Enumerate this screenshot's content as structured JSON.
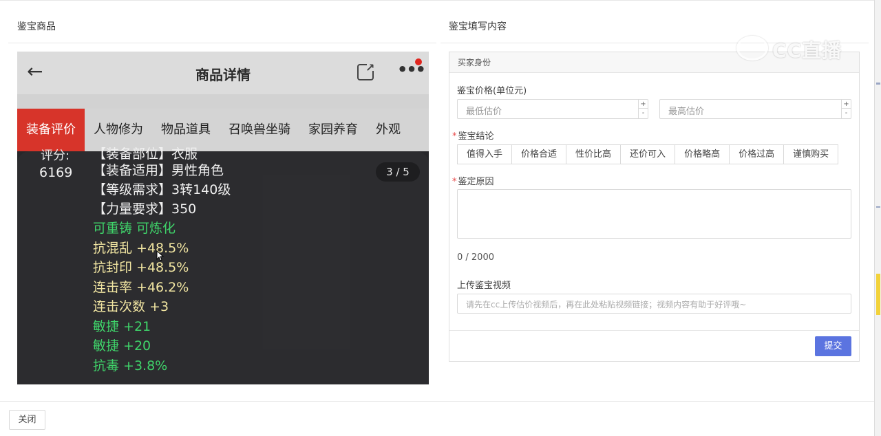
{
  "left_section": {
    "title": "鉴宝商品"
  },
  "right_section": {
    "title": "鉴宝填写内容"
  },
  "phone": {
    "header_title": "商品详情",
    "tabs": [
      "装备评价",
      "人物修为",
      "物品道具",
      "召唤兽坐骑",
      "家园养育",
      "外观"
    ],
    "score_label": "评分:",
    "score_value": "6169",
    "pager": "3 / 5",
    "attributes": [
      {
        "text": "【装备部位】衣服",
        "color": "white"
      },
      {
        "text": "【装备适用】男性角色",
        "color": "white"
      },
      {
        "text": "【等级需求】3转140级",
        "color": "white"
      },
      {
        "text": "【力量要求】350",
        "color": "white"
      },
      {
        "text": "可重铸 可炼化",
        "color": "green"
      },
      {
        "text": "抗混乱 +48.5%",
        "color": "yellow"
      },
      {
        "text": "抗封印 +48.5%",
        "color": "yellow"
      },
      {
        "text": "连击率 +46.2%",
        "color": "yellow"
      },
      {
        "text": "连击次数 +3",
        "color": "yellow"
      },
      {
        "text": "敏捷 +21",
        "color": "green"
      },
      {
        "text": "敏捷 +20",
        "color": "green"
      },
      {
        "text": "抗毒 +3.8%",
        "color": "green"
      }
    ]
  },
  "form": {
    "header": "买家身份",
    "price_label": "鉴宝价格(单位元)",
    "min_placeholder": "最低估价",
    "max_placeholder": "最高估价",
    "stepper_up": "+",
    "stepper_down": "-",
    "required_mark": "*",
    "conclusion_label": "鉴宝结论",
    "conclusion_options": [
      "值得入手",
      "价格合适",
      "性价比高",
      "还价可入",
      "价格略高",
      "价格过高",
      "谨慎购买"
    ],
    "reason_label": "鉴定原因",
    "reason_counter": "0 / 2000",
    "video_label": "上传鉴宝视频",
    "video_placeholder": "请先在cc上传估价视频后，再在此处粘贴视频链接；视频内容有助于好评哦~",
    "submit_label": "提交"
  },
  "watermark": {
    "text": "CC直播"
  },
  "footer": {
    "close_label": "关闭"
  },
  "colors": {
    "accent": "#5b74e0",
    "tab_active": "#d7342a",
    "required": "#e84a4a",
    "attr_green": "#3fd46a",
    "attr_yellow": "#f2e6a2"
  }
}
